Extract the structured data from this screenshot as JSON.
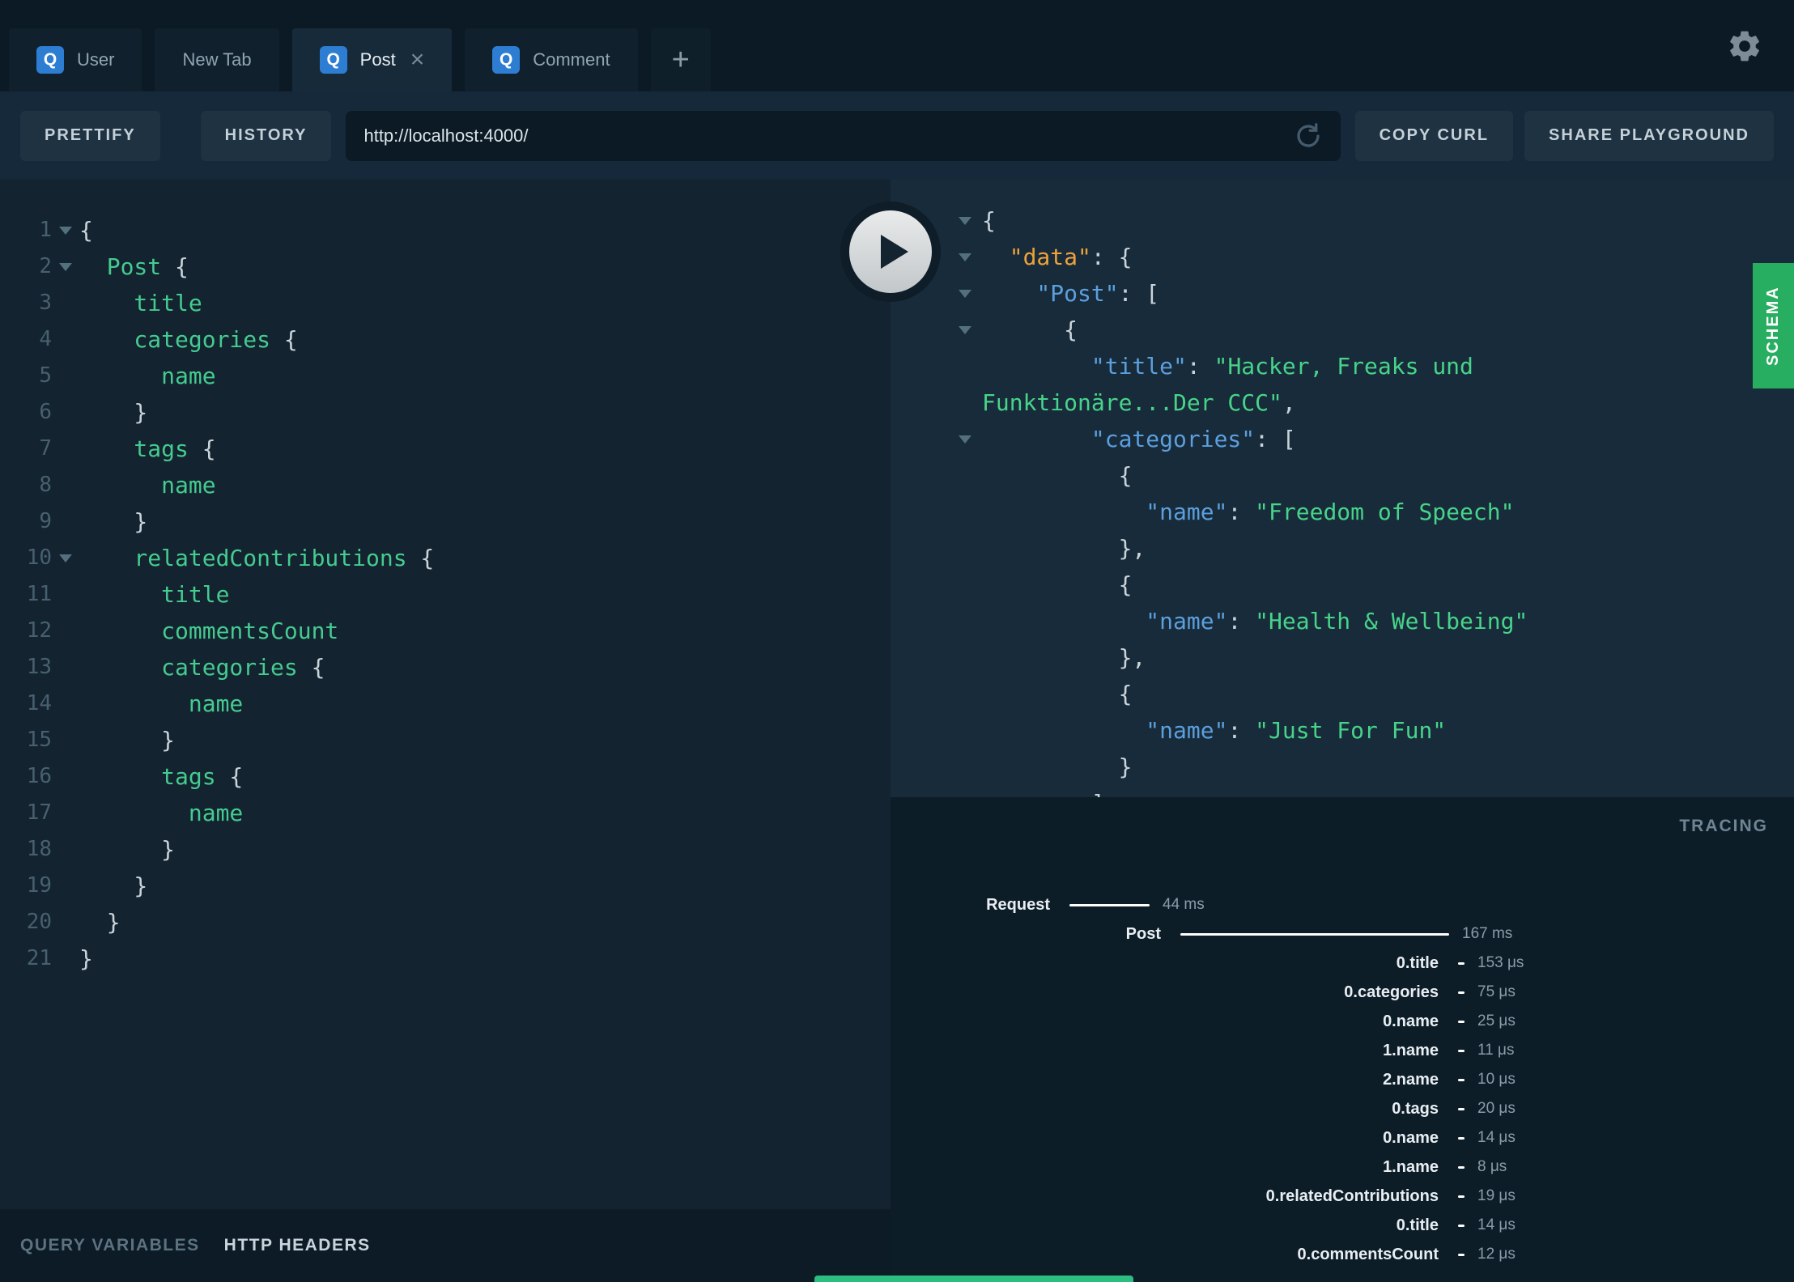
{
  "tabs": {
    "query_badge": "Q",
    "items": [
      {
        "label": "User",
        "has_icon": true,
        "active": false,
        "closable": false
      },
      {
        "label": "New Tab",
        "has_icon": false,
        "active": false,
        "closable": false
      },
      {
        "label": "Post",
        "has_icon": true,
        "active": true,
        "closable": true
      },
      {
        "label": "Comment",
        "has_icon": true,
        "active": false,
        "closable": false
      }
    ],
    "new_tab_label": "+"
  },
  "toolbar": {
    "prettify_label": "PRETTIFY",
    "history_label": "HISTORY",
    "url_value": "http://localhost:4000/",
    "copy_curl_label": "COPY CURL",
    "share_label": "SHARE PLAYGROUND"
  },
  "editor": {
    "lines": [
      {
        "n": 1,
        "fold": true,
        "parts": [
          {
            "c": "w",
            "v": "{"
          }
        ]
      },
      {
        "n": 2,
        "fold": true,
        "parts": [
          {
            "c": "g",
            "v": "  Post"
          },
          {
            "c": "w",
            "v": " {"
          }
        ]
      },
      {
        "n": 3,
        "fold": false,
        "parts": [
          {
            "c": "g",
            "v": "    title"
          }
        ]
      },
      {
        "n": 4,
        "fold": false,
        "parts": [
          {
            "c": "g",
            "v": "    categories"
          },
          {
            "c": "w",
            "v": " {"
          }
        ]
      },
      {
        "n": 5,
        "fold": false,
        "parts": [
          {
            "c": "g",
            "v": "      name"
          }
        ]
      },
      {
        "n": 6,
        "fold": false,
        "parts": [
          {
            "c": "w",
            "v": "    }"
          }
        ]
      },
      {
        "n": 7,
        "fold": false,
        "parts": [
          {
            "c": "g",
            "v": "    tags"
          },
          {
            "c": "w",
            "v": " {"
          }
        ]
      },
      {
        "n": 8,
        "fold": false,
        "parts": [
          {
            "c": "g",
            "v": "      name"
          }
        ]
      },
      {
        "n": 9,
        "fold": false,
        "parts": [
          {
            "c": "w",
            "v": "    }"
          }
        ]
      },
      {
        "n": 10,
        "fold": true,
        "parts": [
          {
            "c": "g",
            "v": "    relatedContributions"
          },
          {
            "c": "w",
            "v": " {"
          }
        ]
      },
      {
        "n": 11,
        "fold": false,
        "parts": [
          {
            "c": "g",
            "v": "      title"
          }
        ]
      },
      {
        "n": 12,
        "fold": false,
        "parts": [
          {
            "c": "g",
            "v": "      commentsCount"
          }
        ]
      },
      {
        "n": 13,
        "fold": false,
        "parts": [
          {
            "c": "g",
            "v": "      categories"
          },
          {
            "c": "w",
            "v": " {"
          }
        ]
      },
      {
        "n": 14,
        "fold": false,
        "parts": [
          {
            "c": "g",
            "v": "        name"
          }
        ]
      },
      {
        "n": 15,
        "fold": false,
        "parts": [
          {
            "c": "w",
            "v": "      }"
          }
        ]
      },
      {
        "n": 16,
        "fold": false,
        "parts": [
          {
            "c": "g",
            "v": "      tags"
          },
          {
            "c": "w",
            "v": " {"
          }
        ]
      },
      {
        "n": 17,
        "fold": false,
        "parts": [
          {
            "c": "g",
            "v": "        name"
          }
        ]
      },
      {
        "n": 18,
        "fold": false,
        "parts": [
          {
            "c": "w",
            "v": "      }"
          }
        ]
      },
      {
        "n": 19,
        "fold": false,
        "parts": [
          {
            "c": "w",
            "v": "    }"
          }
        ]
      },
      {
        "n": 20,
        "fold": false,
        "parts": [
          {
            "c": "w",
            "v": "  }"
          }
        ]
      },
      {
        "n": 21,
        "fold": false,
        "parts": [
          {
            "c": "w",
            "v": "}"
          }
        ]
      }
    ]
  },
  "bottom": {
    "query_variables_label": "QUERY VARIABLES",
    "http_headers_label": "HTTP HEADERS"
  },
  "response": {
    "lines": [
      {
        "caret": true,
        "parts": [
          {
            "c": "w",
            "v": "{"
          }
        ]
      },
      {
        "caret": true,
        "parts": [
          {
            "c": "o",
            "v": "  \"data\""
          },
          {
            "c": "w",
            "v": ": {"
          }
        ]
      },
      {
        "caret": true,
        "parts": [
          {
            "c": "b",
            "v": "    \"Post\""
          },
          {
            "c": "w",
            "v": ": ["
          }
        ]
      },
      {
        "caret": true,
        "parts": [
          {
            "c": "w",
            "v": "      {"
          }
        ]
      },
      {
        "caret": false,
        "parts": [
          {
            "c": "b",
            "v": "        \"title\""
          },
          {
            "c": "w",
            "v": ": "
          },
          {
            "c": "s",
            "v": "\"Hacker, Freaks und"
          }
        ]
      },
      {
        "caret": false,
        "parts": [
          {
            "c": "s",
            "v": "Funktionäre...Der CCC\""
          },
          {
            "c": "w",
            "v": ","
          }
        ]
      },
      {
        "caret": true,
        "parts": [
          {
            "c": "b",
            "v": "        \"categories\""
          },
          {
            "c": "w",
            "v": ": ["
          }
        ]
      },
      {
        "caret": false,
        "parts": [
          {
            "c": "w",
            "v": "          {"
          }
        ]
      },
      {
        "caret": false,
        "parts": [
          {
            "c": "b",
            "v": "            \"name\""
          },
          {
            "c": "w",
            "v": ": "
          },
          {
            "c": "s",
            "v": "\"Freedom of Speech\""
          }
        ]
      },
      {
        "caret": false,
        "parts": [
          {
            "c": "w",
            "v": "          },"
          }
        ]
      },
      {
        "caret": false,
        "parts": [
          {
            "c": "w",
            "v": "          {"
          }
        ]
      },
      {
        "caret": false,
        "parts": [
          {
            "c": "b",
            "v": "            \"name\""
          },
          {
            "c": "w",
            "v": ": "
          },
          {
            "c": "s",
            "v": "\"Health & Wellbeing\""
          }
        ]
      },
      {
        "caret": false,
        "parts": [
          {
            "c": "w",
            "v": "          },"
          }
        ]
      },
      {
        "caret": false,
        "parts": [
          {
            "c": "w",
            "v": "          {"
          }
        ]
      },
      {
        "caret": false,
        "parts": [
          {
            "c": "b",
            "v": "            \"name\""
          },
          {
            "c": "w",
            "v": ": "
          },
          {
            "c": "s",
            "v": "\"Just For Fun\""
          }
        ]
      },
      {
        "caret": false,
        "parts": [
          {
            "c": "w",
            "v": "          }"
          }
        ]
      },
      {
        "caret": false,
        "parts": [
          {
            "c": "w",
            "v": "        ]"
          }
        ]
      }
    ]
  },
  "side": {
    "schema_label": "SCHEMA"
  },
  "tracing": {
    "title": "TRACING",
    "rows": [
      {
        "label": "Request",
        "time": "44 ms",
        "level": 0,
        "bar": 99
      },
      {
        "label": "Post",
        "time": "167 ms",
        "level": 1,
        "bar": 332
      },
      {
        "label": "0.title",
        "time": "153 μs",
        "level": 2,
        "bar": 8
      },
      {
        "label": "0.categories",
        "time": "75 μs",
        "level": 2,
        "bar": 8
      },
      {
        "label": "0.name",
        "time": "25 μs",
        "level": 2,
        "bar": 8
      },
      {
        "label": "1.name",
        "time": "11 μs",
        "level": 2,
        "bar": 8
      },
      {
        "label": "2.name",
        "time": "10 μs",
        "level": 2,
        "bar": 8
      },
      {
        "label": "0.tags",
        "time": "20 μs",
        "level": 2,
        "bar": 8
      },
      {
        "label": "0.name",
        "time": "14 μs",
        "level": 2,
        "bar": 8
      },
      {
        "label": "1.name",
        "time": "8 μs",
        "level": 2,
        "bar": 8
      },
      {
        "label": "0.relatedContributions",
        "time": "19 μs",
        "level": 2,
        "bar": 8
      },
      {
        "label": "0.title",
        "time": "14 μs",
        "level": 2,
        "bar": 8
      },
      {
        "label": "0.commentsCount",
        "time": "12 μs",
        "level": 2,
        "bar": 8
      }
    ]
  },
  "colors": {
    "badge_blue": "#2d7ed3",
    "schema_green": "#27ae60",
    "query_field_green": "#45cb90",
    "response_key_blue": "#5c9fdd",
    "response_data_orange": "#efa23b",
    "response_string_green": "#47d48a"
  }
}
